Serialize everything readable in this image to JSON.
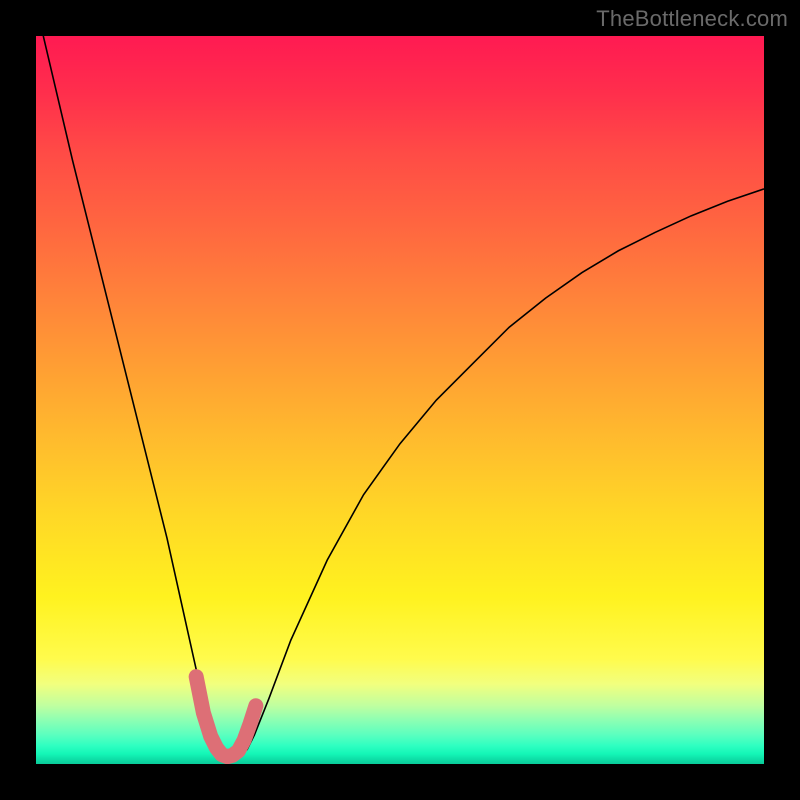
{
  "watermark": "TheBottleneck.com",
  "chart_data": {
    "type": "line",
    "title": "",
    "xlabel": "",
    "ylabel": "",
    "xlim": [
      0,
      100
    ],
    "ylim": [
      0,
      100
    ],
    "grid": false,
    "legend": false,
    "series": [
      {
        "name": "curve",
        "stroke": "#000000",
        "strokeWidth": 1.6,
        "x": [
          1,
          5,
          10,
          15,
          18,
          20,
          22,
          24,
          25,
          26,
          27,
          28,
          29,
          30,
          32,
          35,
          40,
          45,
          50,
          55,
          60,
          65,
          70,
          75,
          80,
          85,
          90,
          95,
          100
        ],
        "y": [
          100,
          83,
          63,
          43,
          31,
          22,
          13,
          5,
          2.5,
          1.3,
          0.9,
          1.2,
          2,
          4,
          9,
          17,
          28,
          37,
          44,
          50,
          55,
          60,
          64,
          67.5,
          70.5,
          73,
          75.3,
          77.3,
          79
        ]
      },
      {
        "name": "highlight",
        "stroke": "#dd6f76",
        "strokeWidth": 15,
        "linecap": "round",
        "x": [
          22.0,
          23.0,
          24.0,
          24.8,
          25.5,
          26.3,
          27.0,
          27.8,
          28.6,
          29.4,
          30.2
        ],
        "y": [
          12.0,
          7.0,
          3.8,
          2.2,
          1.3,
          1.0,
          1.2,
          1.8,
          3.3,
          5.5,
          8.0
        ]
      }
    ],
    "background_gradient": {
      "direction": "vertical",
      "stops": [
        {
          "pos": 0.0,
          "color": "#ff1a52"
        },
        {
          "pos": 0.26,
          "color": "#ff6640"
        },
        {
          "pos": 0.56,
          "color": "#ffbd2d"
        },
        {
          "pos": 0.77,
          "color": "#fff21f"
        },
        {
          "pos": 0.92,
          "color": "#bfffa0"
        },
        {
          "pos": 1.0,
          "color": "#0acb99"
        }
      ]
    }
  }
}
